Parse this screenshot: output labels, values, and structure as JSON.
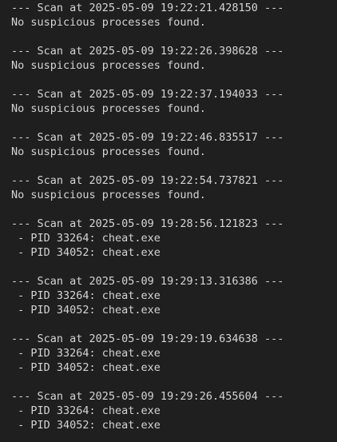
{
  "scans": [
    {
      "header": "--- Scan at 2025-05-09 19:22:21.428150 ---",
      "lines": [
        "No suspicious processes found."
      ]
    },
    {
      "header": "--- Scan at 2025-05-09 19:22:26.398628 ---",
      "lines": [
        "No suspicious processes found."
      ]
    },
    {
      "header": "--- Scan at 2025-05-09 19:22:37.194033 ---",
      "lines": [
        "No suspicious processes found."
      ]
    },
    {
      "header": "--- Scan at 2025-05-09 19:22:46.835517 ---",
      "lines": [
        "No suspicious processes found."
      ]
    },
    {
      "header": "--- Scan at 2025-05-09 19:22:54.737821 ---",
      "lines": [
        "No suspicious processes found."
      ]
    },
    {
      "header": "--- Scan at 2025-05-09 19:28:56.121823 ---",
      "lines": [
        " - PID 33264: cheat.exe",
        " - PID 34052: cheat.exe"
      ]
    },
    {
      "header": "--- Scan at 2025-05-09 19:29:13.316386 ---",
      "lines": [
        " - PID 33264: cheat.exe",
        " - PID 34052: cheat.exe"
      ]
    },
    {
      "header": "--- Scan at 2025-05-09 19:29:19.634638 ---",
      "lines": [
        " - PID 33264: cheat.exe",
        " - PID 34052: cheat.exe"
      ]
    },
    {
      "header": "--- Scan at 2025-05-09 19:29:26.455604 ---",
      "lines": [
        " - PID 33264: cheat.exe",
        " - PID 34052: cheat.exe"
      ]
    }
  ]
}
